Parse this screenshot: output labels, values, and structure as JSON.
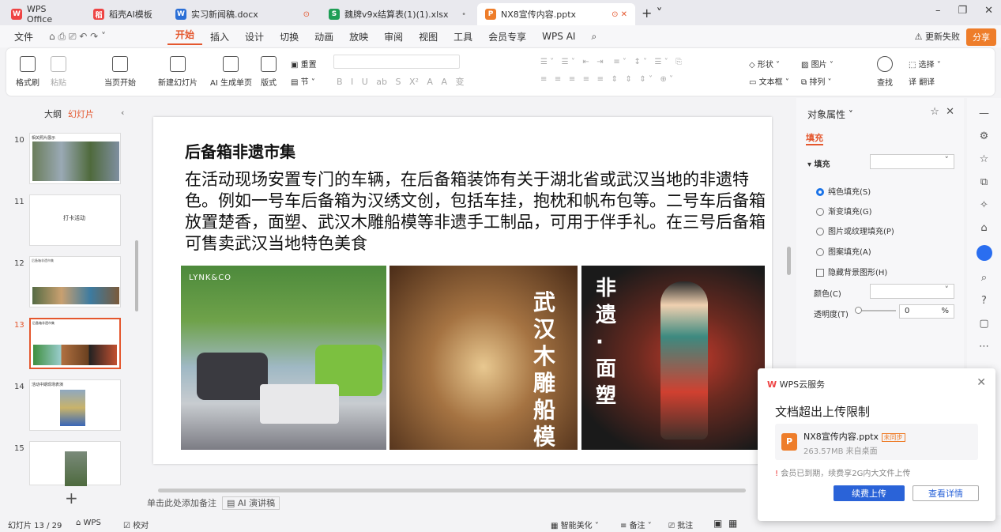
{
  "tabs": [
    {
      "label": "WPS Office",
      "icon": "W",
      "color": "#e44"
    },
    {
      "label": "稻壳AI模板",
      "icon": "稻",
      "color": "#e44"
    },
    {
      "label": "实习新闻稿.docx",
      "icon": "W",
      "color": "#2b6fd6"
    },
    {
      "label": "魏牌v9x结算表(1)(1).xlsx",
      "icon": "S",
      "color": "#1e9e55"
    },
    {
      "label": "NX8宣传内容.pptx",
      "icon": "P",
      "color": "#ee7d2a"
    }
  ],
  "menu": [
    "文件",
    "开始",
    "插入",
    "设计",
    "切换",
    "动画",
    "放映",
    "审阅",
    "视图",
    "工具",
    "会员专享",
    "WPS AI"
  ],
  "topright": {
    "sync": "更新失败",
    "share": "分享"
  },
  "ribbon": {
    "format_painter": "格式刷",
    "paste": "粘贴",
    "from_start": "当页开始",
    "new_slide": "新建幻灯片",
    "ai_slide": "AI 生成单页",
    "layout": "版式",
    "reset": "重置",
    "section": "节",
    "shape": "形状",
    "image": "图片",
    "textbox": "文本框",
    "arrange": "排列",
    "find": "查找",
    "select": "选择",
    "translate": "翻译"
  },
  "sidebar": {
    "outline": "大纲",
    "slides": "幻灯片",
    "items": [
      {
        "num": "10",
        "caption": "相关照片展示"
      },
      {
        "num": "11",
        "caption": "打卡活动"
      },
      {
        "num": "12",
        "caption": "后备箱非遗市集"
      },
      {
        "num": "13",
        "caption": "后备箱非遗市集"
      },
      {
        "num": "14",
        "caption": "活动中期现场表演"
      },
      {
        "num": "15",
        "caption": ""
      }
    ]
  },
  "slide": {
    "title": "后备箱非遗市集",
    "body": "在活动现场安置专门的车辆，在后备箱装饰有关于湖北省或武汉当地的非遗特色。例如一号车后备箱为汉绣文创，包括车挂，抱枕和帆布包等。二号车后备箱放置楚香，面塑、武汉木雕船模等非遗手工制品，可用于伴手礼。在三号后备箱可售卖武汉当地特色美食",
    "photo2_text": "武汉木雕船模",
    "photo3_text": "非遗·面塑",
    "photo1_text": "LYNK&CO"
  },
  "notes": {
    "placeholder": "单击此处添加备注",
    "ai": "AI 演讲稿"
  },
  "props": {
    "title": "对象属性",
    "tab": "填充",
    "section": "填充",
    "options": [
      "纯色填充(S)",
      "渐变填充(G)",
      "图片或纹理填充(P)",
      "图案填充(A)"
    ],
    "hide_bg": "隐藏背景图形(H)",
    "color": "颜色(C)",
    "transparency": "透明度(T)",
    "transparency_value": "0",
    "unit": "%"
  },
  "popup": {
    "brand": "WPS云服务",
    "title": "文档超出上传限制",
    "file": "NX8宣传内容.pptx",
    "badge": "未同步",
    "meta": "263.57MB  来自桌面",
    "warn": "会员已到期，续费享2G内大文件上传",
    "renew": "续费上传",
    "details": "查看详情"
  },
  "status": {
    "slide": "幻灯片 13 / 29",
    "wps": "WPS",
    "proof": "校对",
    "beautify": "智能美化",
    "notes": "备注",
    "comments": "批注"
  }
}
